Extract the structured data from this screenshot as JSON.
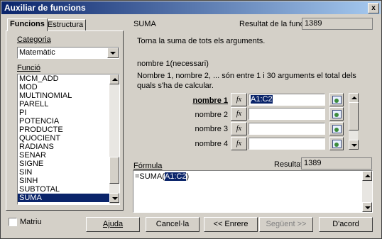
{
  "window": {
    "title": "Auxiliar de funcions",
    "close_glyph": "x"
  },
  "tabs": [
    {
      "label": "Funcions"
    },
    {
      "label": "Estructura"
    }
  ],
  "category": {
    "label": "Categoria",
    "value": "Matemàtic"
  },
  "function_list": {
    "label": "Funció",
    "items": [
      "MCM_ADD",
      "MOD",
      "MULTINOMIAL",
      "PARELL",
      "PI",
      "POTENCIA",
      "PRODUCTE",
      "QUOCIENT",
      "RADIANS",
      "SENAR",
      "SIGNE",
      "SIN",
      "SINH",
      "SUBTOTAL",
      "SUMA"
    ],
    "selected": "SUMA"
  },
  "function": {
    "name": "SUMA",
    "result_label": "Resultat de la funció",
    "result_value": "1389",
    "description": "Torna la suma de tots els arguments.",
    "param_title": "nombre 1(necessari)",
    "param_desc": "Nombre 1, nombre 2, ... són entre 1 i 30 arguments el total dels quals s'ha de calcular."
  },
  "arguments": [
    {
      "label": "nombre 1",
      "value": "A1:C2"
    },
    {
      "label": "nombre 2",
      "value": ""
    },
    {
      "label": "nombre 3",
      "value": ""
    },
    {
      "label": "nombre 4",
      "value": ""
    }
  ],
  "fx_glyph": "fx",
  "formula": {
    "label": "Fórmula",
    "result_label": "Resultat",
    "result_value": "1389",
    "text_prefix": "=SUMA(",
    "text_selected": "A1:C2",
    "text_suffix": ")"
  },
  "matrix": {
    "label": "Matriu",
    "checked": false
  },
  "buttons": {
    "help": "Ajuda",
    "cancel": "Cancel·la",
    "back": "<< Enrere",
    "next": "Següent >>",
    "ok": "D'acord"
  }
}
